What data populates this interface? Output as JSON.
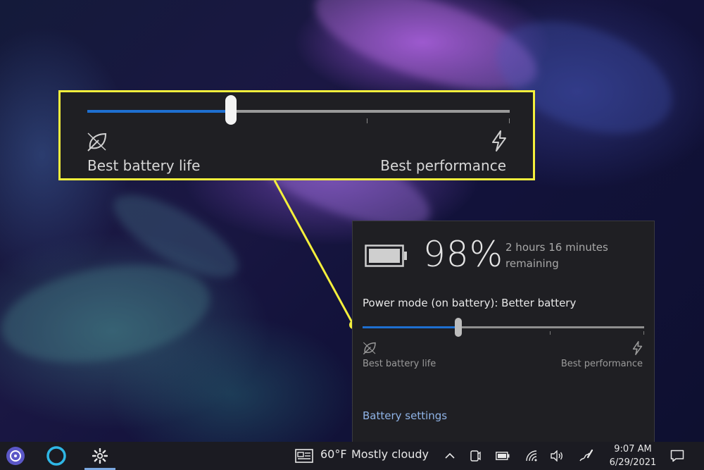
{
  "callout": {
    "slider_level_percent": 34,
    "left_label": "Best battery life",
    "right_label": "Best performance",
    "left_icon": "leaf-icon",
    "right_icon": "lightning-bolt-icon",
    "border_color": "#f4ef3c"
  },
  "flyout": {
    "battery_percent": "98%",
    "remaining_text": "2 hours 16 minutes remaining",
    "power_mode_label": "Power mode (on battery): Better battery",
    "slider_level_percent": 34,
    "left_label": "Best battery life",
    "right_label": "Best performance",
    "battery_settings_link": "Battery settings",
    "accent_color": "#1e6fd0"
  },
  "taskbar": {
    "icons": [
      "alexa-app-icon",
      "cortana-icon",
      "settings-gear-icon",
      "news-icon",
      "chevron-up-icon",
      "meet-now-icon",
      "battery-icon",
      "wifi-icon",
      "volume-icon",
      "pen-icon",
      "notifications-icon"
    ],
    "weather_temp": "60°F",
    "weather_desc": "Mostly cloudy",
    "time": "9:07 AM",
    "date": "6/29/2021"
  }
}
